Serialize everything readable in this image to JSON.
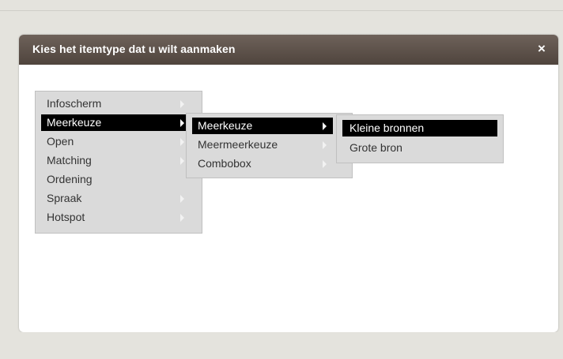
{
  "dialog": {
    "title": "Kies het itemtype dat u wilt aanmaken",
    "close_label": "×"
  },
  "menu_level1": {
    "items": [
      {
        "label": "Infoscherm",
        "has_submenu": true
      },
      {
        "label": "Meerkeuze",
        "has_submenu": true,
        "active": true
      },
      {
        "label": "Open",
        "has_submenu": true
      },
      {
        "label": "Matching",
        "has_submenu": true
      },
      {
        "label": "Ordening",
        "has_submenu": false
      },
      {
        "label": "Spraak",
        "has_submenu": true
      },
      {
        "label": "Hotspot",
        "has_submenu": true
      }
    ]
  },
  "menu_level2": {
    "items": [
      {
        "label": "Meerkeuze",
        "has_submenu": true,
        "active": true
      },
      {
        "label": "Meermeerkeuze",
        "has_submenu": true
      },
      {
        "label": "Combobox",
        "has_submenu": true
      }
    ]
  },
  "menu_level3": {
    "items": [
      {
        "label": "Kleine bronnen",
        "active": true
      },
      {
        "label": "Grote bron"
      }
    ]
  },
  "colors": {
    "titlebar": "#5e534b",
    "menu_bg": "#dadada",
    "active_item": "#000000",
    "page_bg": "#e4e3dd"
  }
}
